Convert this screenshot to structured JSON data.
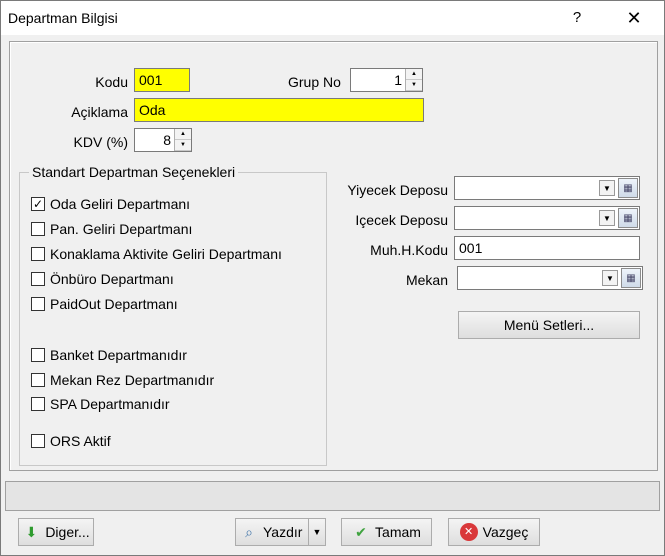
{
  "window": {
    "title": "Departman Bilgisi",
    "help": "?",
    "close": "✕"
  },
  "form": {
    "kodu_label": "Kodu",
    "kodu_value": "001",
    "grup_no_label": "Grup No",
    "grup_no_value": "1",
    "aciklama_label": "Açiklama",
    "aciklama_value": "Oda",
    "kdv_label": "KDV (%)",
    "kdv_value": "8"
  },
  "options": {
    "title": "Standart Departman Seçenekleri",
    "items": [
      {
        "label": "Oda Geliri Departmanı",
        "checked": true,
        "mark": "✓"
      },
      {
        "label": "Pan. Geliri Departmanı",
        "checked": false,
        "mark": ""
      },
      {
        "label": "Konaklama Aktivite Geliri Departmanı",
        "checked": false,
        "mark": ""
      },
      {
        "label": "Önbüro Departmanı",
        "checked": false,
        "mark": ""
      },
      {
        "label": "PaidOut Departmanı",
        "checked": false,
        "mark": ""
      },
      {
        "label": "Banket Departmanıdır",
        "checked": false,
        "mark": ""
      },
      {
        "label": "Mekan Rez Departmanıdır",
        "checked": false,
        "mark": ""
      },
      {
        "label": "SPA Departmanıdır",
        "checked": false,
        "mark": ""
      },
      {
        "label": "ORS Aktif",
        "checked": false,
        "mark": ""
      }
    ]
  },
  "right": {
    "yiyecek_label": "Yiyecek Deposu",
    "yiyecek_value": "",
    "icecek_label": "Içecek Deposu",
    "icecek_value": "",
    "muh_label": "Muh.H.Kodu",
    "muh_value": "001",
    "mekan_label": "Mekan",
    "mekan_value": "",
    "menu_button": "Menü Setleri..."
  },
  "footer": {
    "diger": "Diger...",
    "yazdir": "Yazdır",
    "tamam": "Tamam",
    "vazgec": "Vazgeç"
  },
  "colors": {
    "required_field": "#ffff00",
    "window_bg": "#f0f0f0",
    "cancel_icon": "#d9383a",
    "ok_icon": "#3fa33f",
    "diger_icon": "#2e9b2e"
  }
}
